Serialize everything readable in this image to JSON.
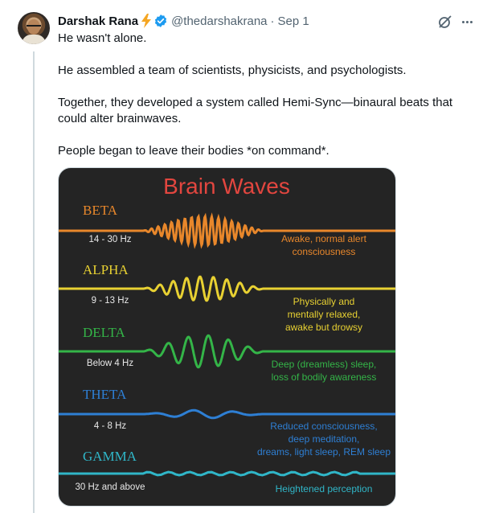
{
  "tweet": {
    "author_name": "Darshak Rana",
    "emoji": "⚡",
    "handle": "@thedarshakrana",
    "separator": "·",
    "date": "Sep 1",
    "paragraphs": [
      "He wasn't alone.",
      "He assembled a team of scientists, physicists, and psychologists.",
      "Together, they developed a system called Hemi-Sync—binaural beats that could alter brainwaves.",
      "People began to leave their bodies *on command*."
    ],
    "icons": {
      "verified": "verified-badge-icon",
      "grok": "grok-icon",
      "more": "more-icon"
    },
    "colors": {
      "verified": "#1d9bf0",
      "bolt": "#f59e0b",
      "secondary_text": "#536471"
    }
  },
  "image": {
    "title": "Brain Waves",
    "title_color": "#e2463f",
    "background": "#242424",
    "waves": [
      {
        "name": "BETA",
        "freq": "14 - 30 Hz",
        "desc": [
          "Awake, normal alert",
          "consciousness"
        ],
        "color": "#e8872b"
      },
      {
        "name": "ALPHA",
        "freq": "9 - 13 Hz",
        "desc": [
          "Physically and",
          "mentally relaxed,",
          "awake but drowsy"
        ],
        "color": "#e8d132"
      },
      {
        "name": "DELTA",
        "freq": "Below 4 Hz",
        "desc": [
          "Deep (dreamless) sleep,",
          "loss of bodily awareness"
        ],
        "color": "#34b548"
      },
      {
        "name": "THETA",
        "freq": "4 - 8 Hz",
        "desc": [
          "Reduced consciousness,",
          "deep meditation,",
          "dreams, light sleep, REM sleep"
        ],
        "color": "#2e7fd4"
      },
      {
        "name": "GAMMA",
        "freq": "30 Hz and above",
        "desc": [
          "Heightened perception"
        ],
        "color": "#30b6c8"
      }
    ]
  }
}
